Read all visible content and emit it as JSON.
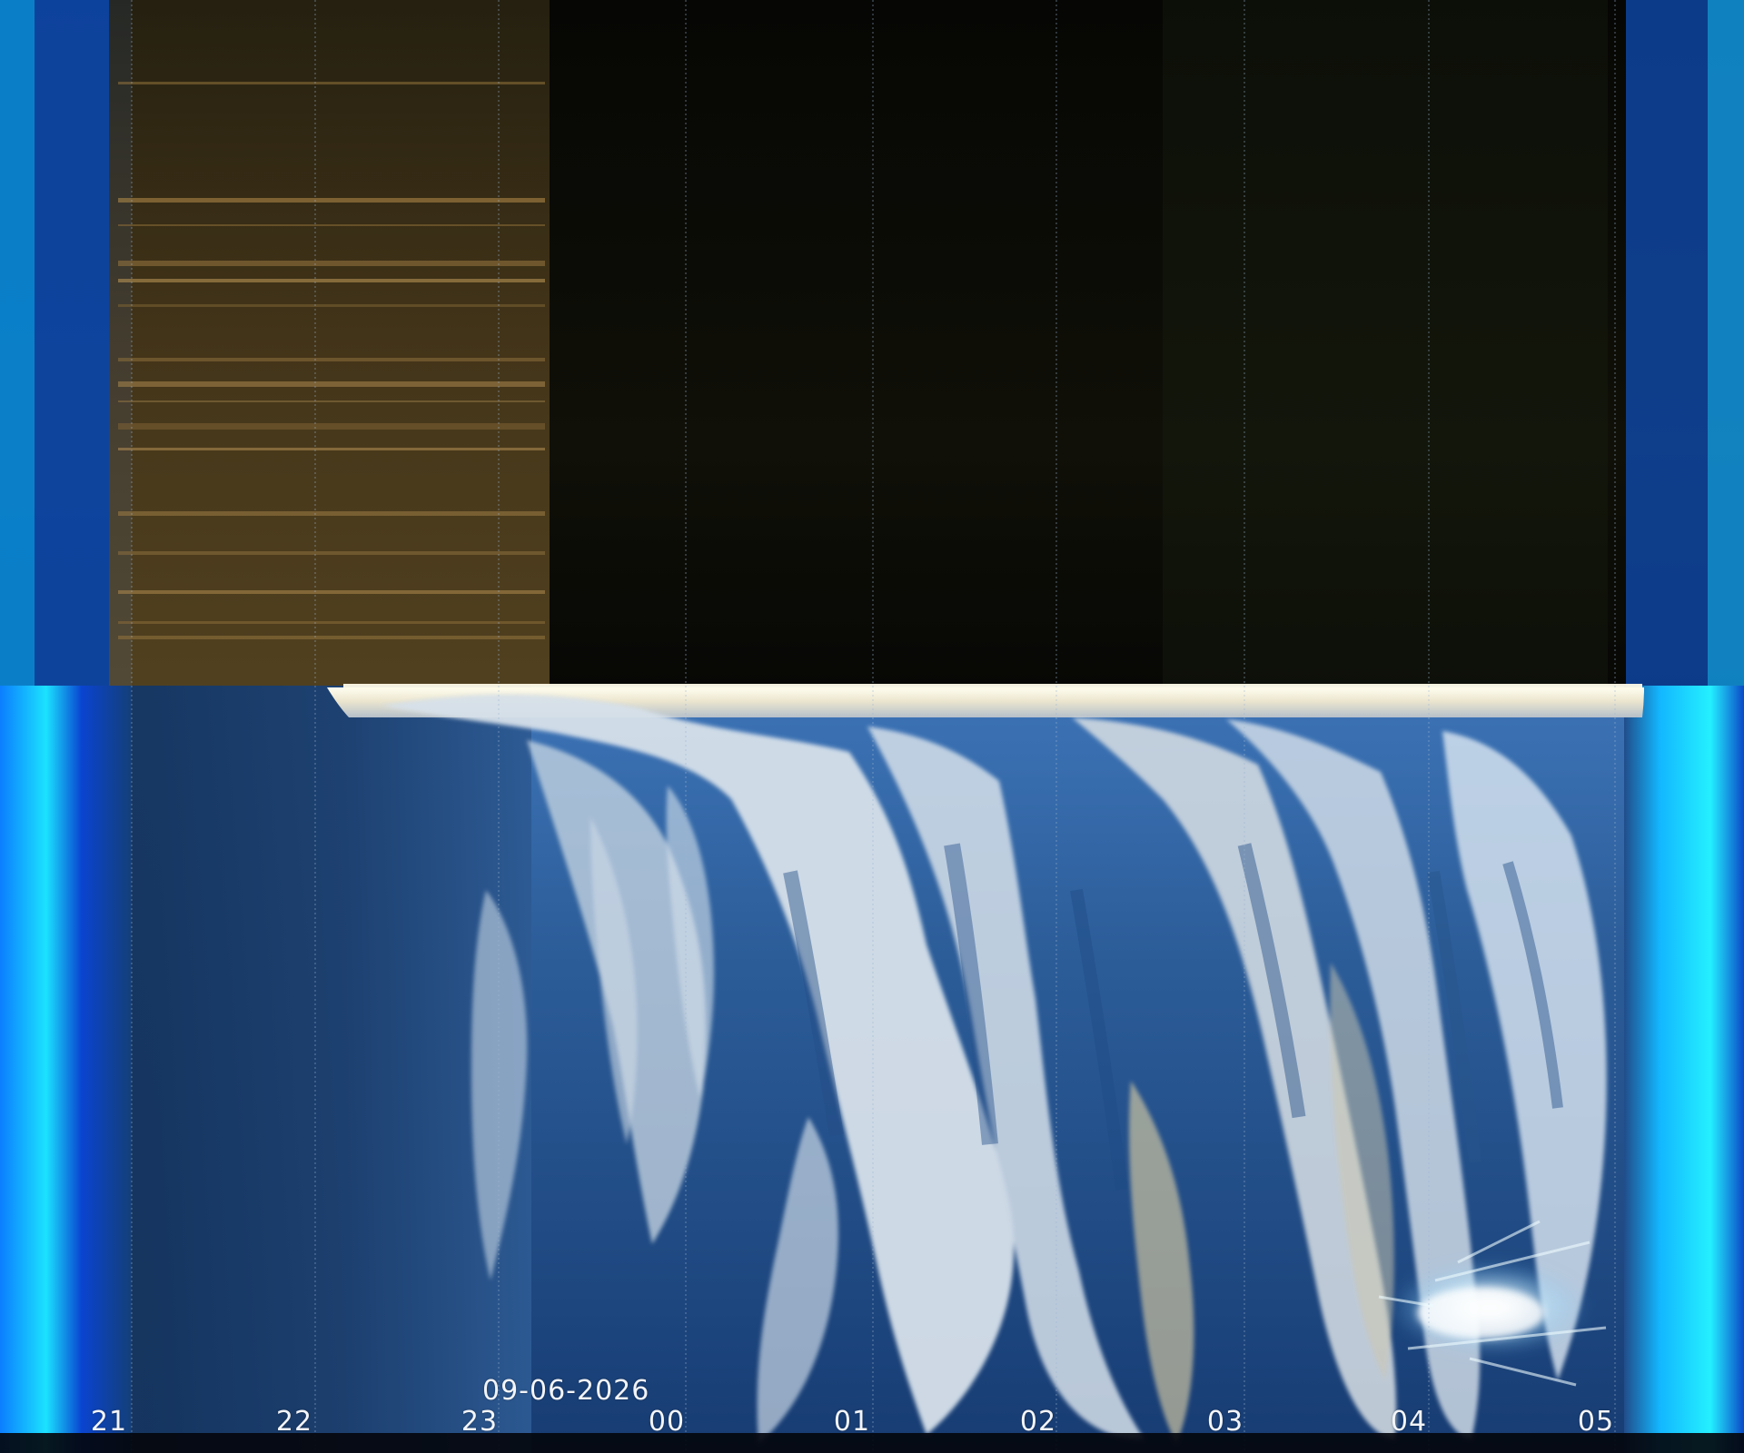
{
  "image": {
    "date_label": "09-06-2026",
    "time_ticks": [
      "21",
      "22",
      "23",
      "00",
      "01",
      "02",
      "03",
      "04",
      "05"
    ]
  },
  "colors": {
    "space_black": "#0b0a04",
    "amber_band": "#5a4921",
    "limb_white": "#f2f0df",
    "ocean_blue": "#2d5a93",
    "edge_blue": "#1f77ff",
    "cloud_white": "#e7eef8",
    "tick_gridline": "#9db6d0"
  }
}
